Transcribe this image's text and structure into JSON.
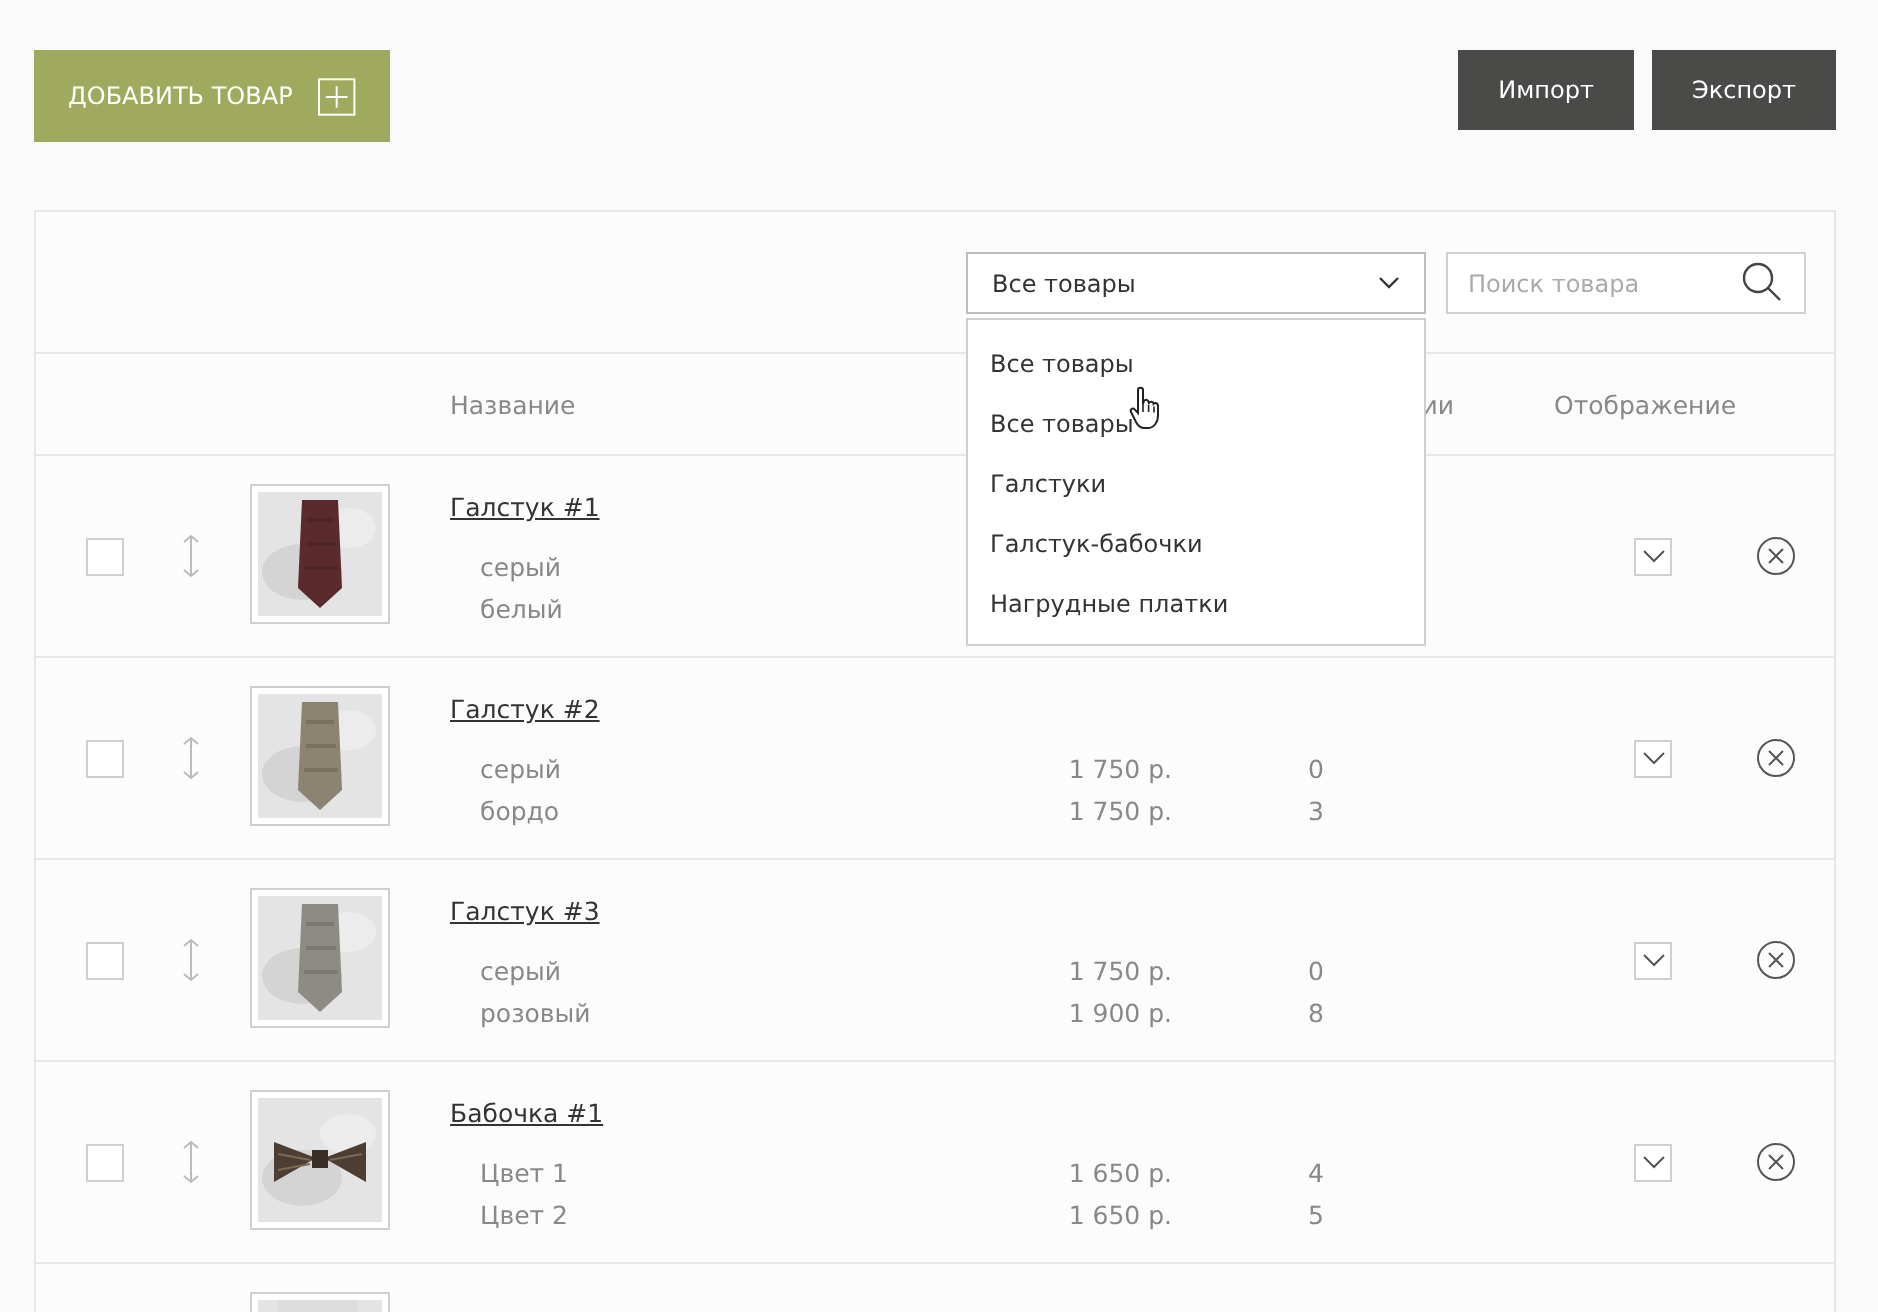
{
  "toolbar": {
    "add_button": "ДОБАВИТЬ ТОВАР",
    "import_button": "Импорт",
    "export_button": "Экспорт"
  },
  "filter": {
    "category_select": {
      "value": "Все товары",
      "expanded": true,
      "options": [
        "Все товары",
        "Все товары",
        "Галстуки",
        "Галстук-бабочки",
        "Нагрудные платки"
      ]
    },
    "search": {
      "placeholder": "Поиск товара"
    }
  },
  "table": {
    "columns": [
      {
        "label": "Название"
      },
      {
        "label": "ии"
      },
      {
        "label": "Отображение"
      }
    ],
    "rows": [
      {
        "name": "Галстук #1",
        "checked": false,
        "visible": true,
        "image": {
          "kind": "picture"
        },
        "variants": [
          {
            "name": "серый"
          },
          {
            "name": "белый"
          }
        ]
      },
      {
        "name": "Галстук #2",
        "checked": false,
        "visible": true,
        "image": {
          "kind": "picture"
        },
        "variants": [
          {
            "name": "серый",
            "price": "1 750 р.",
            "stock": "0"
          },
          {
            "name": "бордо",
            "price": "1 750 р.",
            "stock": "3"
          }
        ]
      },
      {
        "name": "Галстук #3",
        "checked": false,
        "visible": true,
        "image": {
          "kind": "picture"
        },
        "variants": [
          {
            "name": "серый",
            "price": "1 750 р.",
            "stock": "0"
          },
          {
            "name": "розовый",
            "price": "1 900 р.",
            "stock": "8"
          }
        ]
      },
      {
        "name": "Бабочка #1",
        "checked": false,
        "visible": true,
        "image": {
          "kind": "picture"
        },
        "variants": [
          {
            "name": "Цвет 1",
            "price": "1 650 р.",
            "stock": "4"
          },
          {
            "name": "Цвет 2",
            "price": "1 650 р.",
            "stock": "5"
          }
        ]
      },
      {
        "image": {
          "kind": "picture"
        }
      }
    ]
  }
}
